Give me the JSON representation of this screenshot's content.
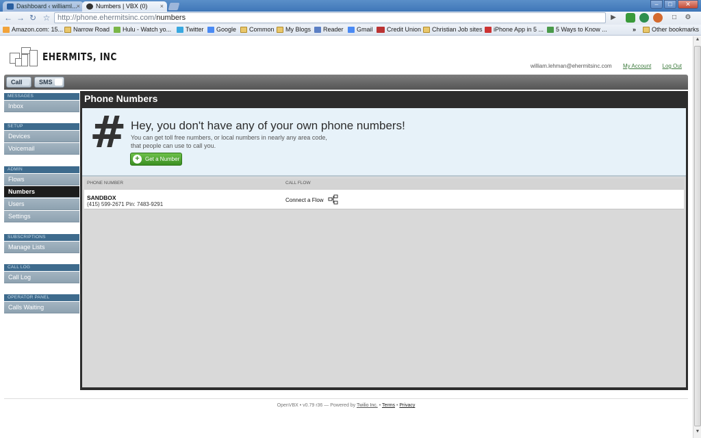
{
  "browser": {
    "tabs": [
      {
        "title": "Dashboard ‹ williaml...",
        "active": false
      },
      {
        "title": "Numbers | VBX (0)",
        "active": true
      }
    ],
    "close_glyph": "×",
    "url_domain": "http://phone.ehermitsinc.com/",
    "url_path": "numbers",
    "bookmarks": [
      {
        "label": "Amazon.com: 15...",
        "icon": "amazon-icon"
      },
      {
        "label": "Narrow Road",
        "icon": "folder-icon"
      },
      {
        "label": "Hulu - Watch yo...",
        "icon": "hulu-icon"
      },
      {
        "label": "Twitter",
        "icon": "twitter-icon"
      },
      {
        "label": "Google",
        "icon": "google-icon"
      },
      {
        "label": "Common",
        "icon": "folder-icon"
      },
      {
        "label": "My Blogs",
        "icon": "folder-icon"
      },
      {
        "label": "Reader",
        "icon": "reader-icon"
      },
      {
        "label": "Gmail",
        "icon": "google-icon"
      },
      {
        "label": "Credit Union",
        "icon": "tla-icon"
      },
      {
        "label": "Christian Job sites",
        "icon": "folder-icon"
      },
      {
        "label": "iPhone App in 5 ...",
        "icon": "site-icon"
      },
      {
        "label": "5 Ways to Know ...",
        "icon": "site-icon"
      }
    ],
    "overflow_chevron": "»",
    "other_bookmarks": "Other bookmarks"
  },
  "app": {
    "logo_text": "EHERMITS, INC",
    "user_email": "william.lehman@ehermitsinc.com",
    "my_account": "My Account",
    "logout": "Log Out",
    "topnav": {
      "call": "Call",
      "sms": "SMS"
    }
  },
  "sidebar": {
    "sections": [
      {
        "title": "MESSAGES",
        "items": [
          {
            "label": "Inbox"
          }
        ]
      },
      {
        "title": "SETUP",
        "items": [
          {
            "label": "Devices"
          },
          {
            "label": "Voicemail"
          }
        ]
      },
      {
        "title": "ADMIN",
        "items": [
          {
            "label": "Flows"
          },
          {
            "label": "Numbers",
            "active": true
          },
          {
            "label": "Users"
          },
          {
            "label": "Settings"
          }
        ]
      },
      {
        "title": "SUBSCRIPTIONS",
        "items": [
          {
            "label": "Manage Lists"
          }
        ]
      },
      {
        "title": "CALL LOG",
        "items": [
          {
            "label": "Call Log"
          }
        ]
      },
      {
        "title": "OPERATOR PANEL",
        "items": [
          {
            "label": "Calls Waiting"
          }
        ]
      }
    ]
  },
  "main": {
    "title": "Phone Numbers",
    "empty": {
      "symbol": "#",
      "heading": "Hey, you don't have any of your own phone numbers!",
      "body": "You can get toll free numbers, or local numbers in nearly any area code, that people can use to call you.",
      "button": "Get a Number",
      "button_icon": "+"
    },
    "table": {
      "columns": [
        "PHONE NUMBER",
        "CALL FLOW"
      ],
      "rows": [
        {
          "name": "SANDBOX",
          "number": "(415) 599-2671 Pin: 7483-9291",
          "flow": "Connect a Flow"
        }
      ]
    }
  },
  "footer": {
    "version": "OpenVBX • v0.79 r36 — Powered by",
    "powered_by": "Twilio Inc.",
    "bullet": "•",
    "terms": "Terms",
    "privacy": "Privacy"
  },
  "colors": {
    "sidebar_section": "#3e6b8d",
    "sidebar_item": "#97a9b7",
    "main_bg": "#2d2d2d",
    "accent_green": "#3b8f22",
    "empty_bg": "#e7f2f9"
  }
}
